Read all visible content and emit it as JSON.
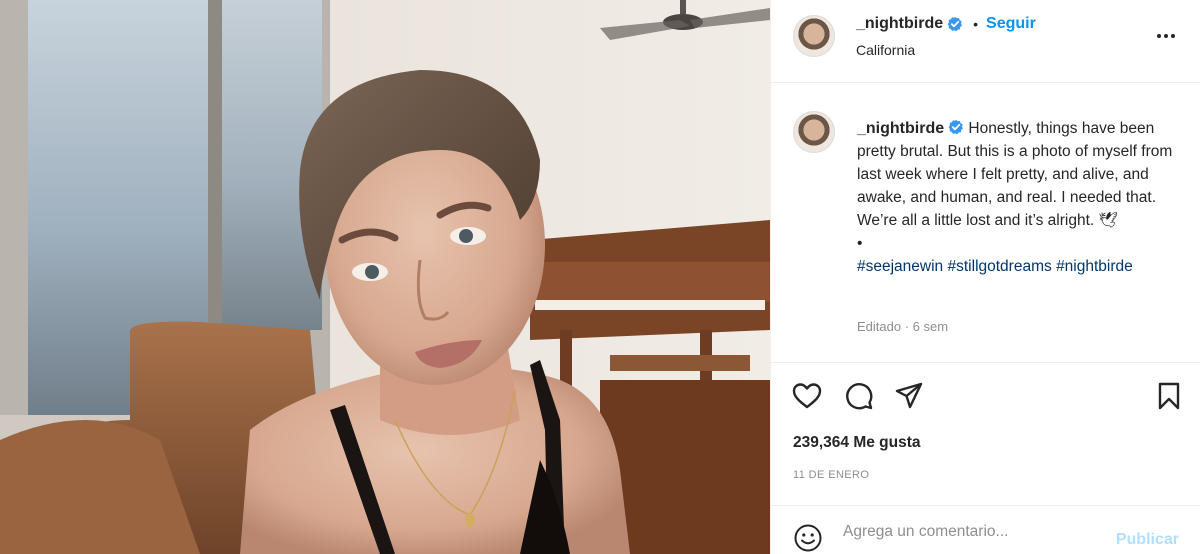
{
  "post": {
    "username": "_nightbirde",
    "follow_label": "Seguir",
    "location": "California",
    "caption": {
      "username": "_nightbirde",
      "text": "Honestly, things have been pretty brutal. But this is a photo of myself from last week where I felt pretty, and alive, and awake, and human, and real. I needed that. We’re all a little lost and it’s alright. 🕊",
      "bullet": "•",
      "hashtags": [
        "#seejanewin",
        "#stillgotdreams",
        "#nightbirde"
      ]
    },
    "edited": "Editado · 6 sem",
    "likes": "239,364 Me gusta",
    "date": "11 DE ENERO",
    "comment_placeholder": "Agrega un comentario...",
    "publish_label": "Publicar"
  },
  "icons": {
    "verified": "verified-badge-icon",
    "more": "more-options-icon",
    "like": "heart-icon",
    "comment": "comment-bubble-icon",
    "share": "paper-plane-icon",
    "save": "bookmark-icon",
    "emoji": "emoji-smiley-icon"
  },
  "colors": {
    "accent": "#0095f6",
    "verified": "#3897f0",
    "hashtag": "#00376b",
    "muted": "#8e8e8e",
    "publish_disabled": "#b2dffc"
  }
}
